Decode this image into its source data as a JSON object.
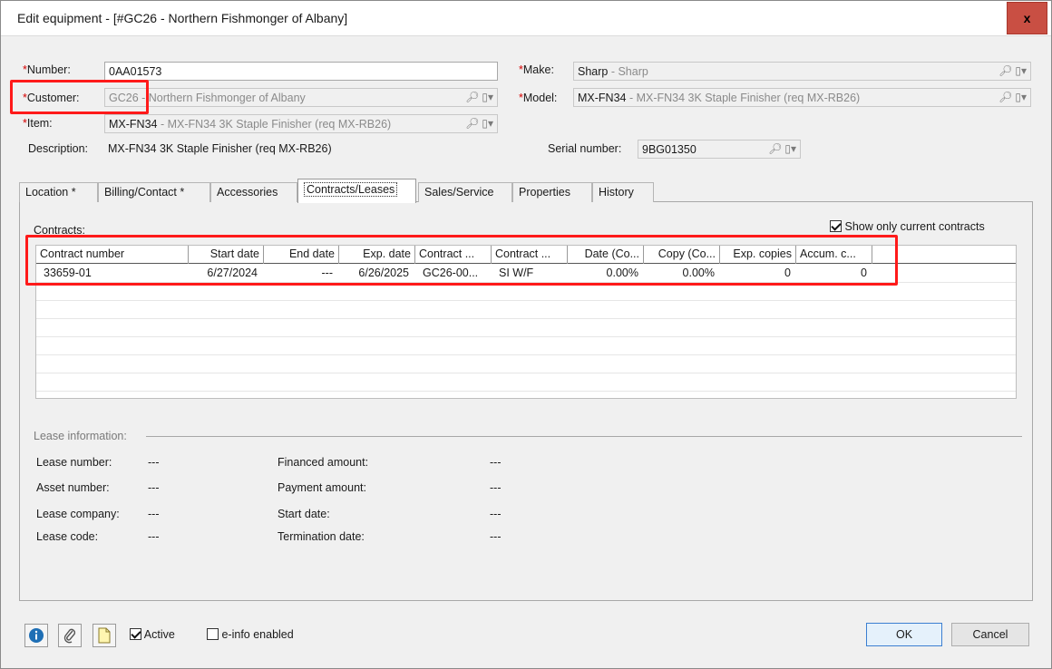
{
  "window": {
    "title": "Edit equipment - [#GC26 - Northern Fishmonger of Albany]",
    "close_label": "x"
  },
  "form": {
    "number": {
      "req": "*",
      "label": "Number:",
      "value": "0AA01573"
    },
    "customer": {
      "req": "*",
      "label": "Customer:",
      "code": "GC26",
      "name": " - Northern Fishmonger of Albany"
    },
    "item": {
      "req": "*",
      "label": "Item:",
      "code": "MX-FN34",
      "name": " - MX-FN34 3K Staple Finisher (req MX-RB26)"
    },
    "description": {
      "label": "Description:",
      "value": "MX-FN34 3K Staple Finisher (req MX-RB26)"
    },
    "make": {
      "req": "*",
      "label": "Make:",
      "code": "Sharp",
      "name": " - Sharp"
    },
    "model": {
      "req": "*",
      "label": "Model:",
      "code": "MX-FN34",
      "name": " - MX-FN34 3K Staple Finisher (req MX-RB26)"
    },
    "serial": {
      "label": "Serial number:",
      "value": "9BG01350"
    }
  },
  "tabs": [
    {
      "label": "Location *"
    },
    {
      "label": "Billing/Contact *"
    },
    {
      "label": "Accessories"
    },
    {
      "label": "Contracts/Leases"
    },
    {
      "label": "Sales/Service"
    },
    {
      "label": "Properties"
    },
    {
      "label": "History"
    }
  ],
  "contracts": {
    "label": "Contracts:",
    "show_current_label": "Show only current contracts",
    "show_current_checked": true,
    "columns": [
      "Contract number",
      "Start date",
      "End date",
      "Exp. date",
      "Contract ...",
      "Contract ...",
      "Date (Co...",
      "Copy (Co...",
      "Exp. copies",
      "Accum. c..."
    ],
    "rows": [
      [
        "33659-01",
        "6/27/2024",
        "---",
        "6/26/2025",
        "GC26-00...",
        "SI W/F",
        "0.00%",
        "0.00%",
        "0",
        "0"
      ]
    ]
  },
  "lease": {
    "section_label": "Lease information:",
    "lease_number": {
      "label": "Lease number:",
      "value": "---"
    },
    "asset_number": {
      "label": "Asset number:",
      "value": "---"
    },
    "lease_company": {
      "label": "Lease company:",
      "value": "---"
    },
    "lease_code": {
      "label": "Lease code:",
      "value": "---"
    },
    "financed_amount": {
      "label": "Financed amount:",
      "value": "---"
    },
    "payment_amount": {
      "label": "Payment amount:",
      "value": "---"
    },
    "start_date": {
      "label": "Start date:",
      "value": "---"
    },
    "termination_date": {
      "label": "Termination date:",
      "value": "---"
    }
  },
  "footer": {
    "active_label": "Active",
    "active_checked": true,
    "einfo_label": "e-info enabled",
    "einfo_checked": false,
    "ok_label": "OK",
    "cancel_label": "Cancel"
  },
  "colors": {
    "required": "#d40000",
    "highlight": "#ff1a1a",
    "close": "#c94f43",
    "info_icon": "#1f6fb5"
  }
}
